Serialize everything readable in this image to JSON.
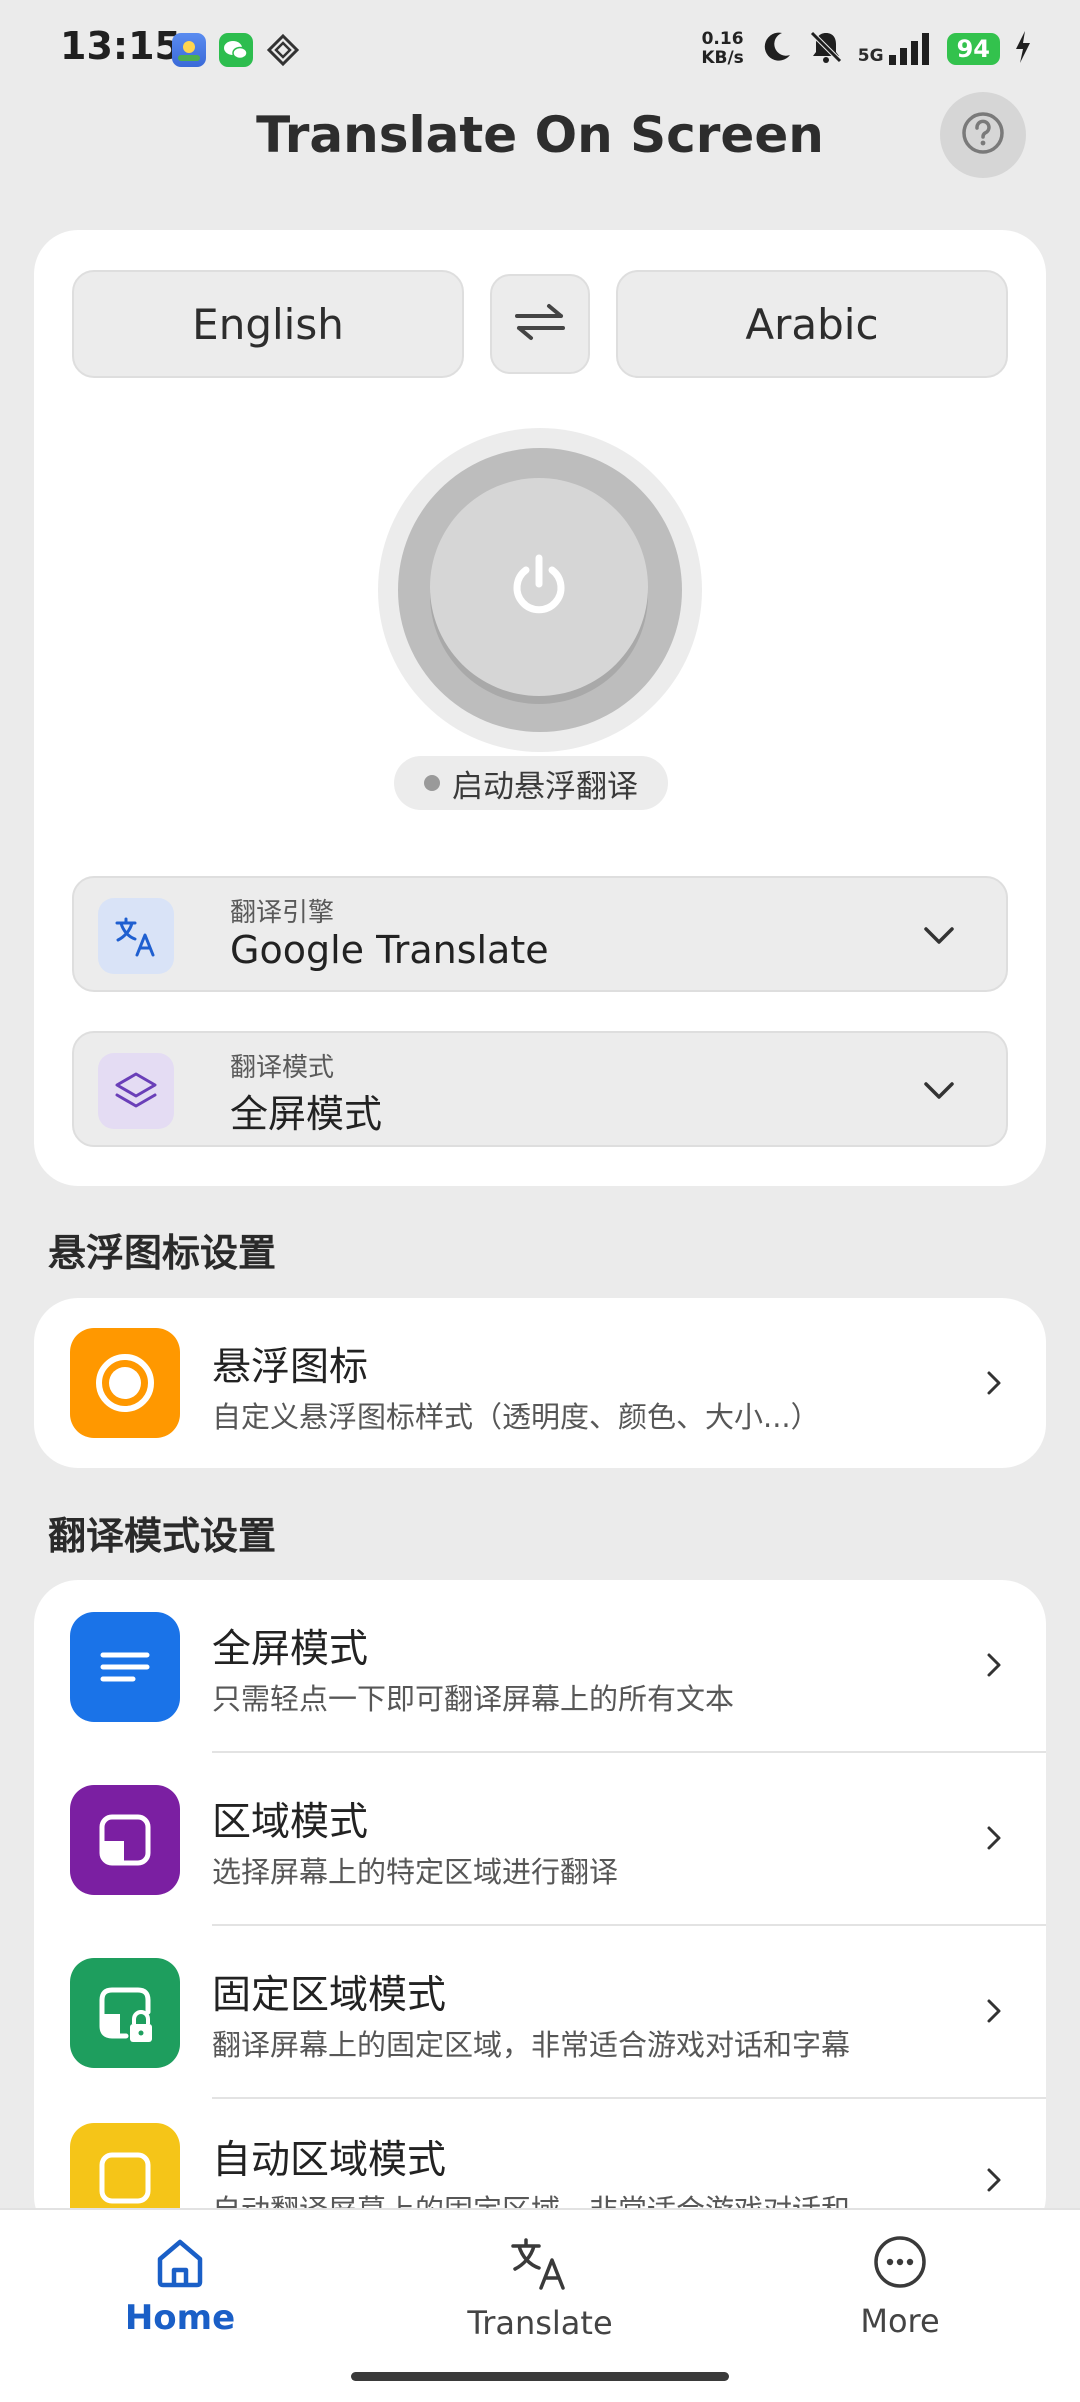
{
  "status_bar": {
    "time": "13:15",
    "net_speed_value": "0.16",
    "net_speed_unit": "KB/s",
    "network": "5G",
    "battery": "94",
    "app_icons": [
      "gallery-app-icon",
      "wechat-icon",
      "vpn-icon"
    ],
    "right_icons": [
      "moon-icon",
      "bell-off-icon",
      "signal-icon",
      "charging-icon"
    ]
  },
  "header": {
    "title": "Translate On Screen",
    "help_icon": "help-icon"
  },
  "languages": {
    "source": "English",
    "target": "Arabic",
    "swap_icon": "swap-icon"
  },
  "power": {
    "icon": "power-icon",
    "status": "启动悬浮翻译"
  },
  "engine": {
    "label": "翻译引擎",
    "value": "Google Translate",
    "icon": "translate-icon"
  },
  "mode": {
    "label": "翻译模式",
    "value": "全屏模式",
    "icon": "layers-icon"
  },
  "floating_section": {
    "title": "悬浮图标设置",
    "item": {
      "title": "悬浮图标",
      "subtitle": "自定义悬浮图标样式（透明度、颜色、大小...）",
      "icon": "floating-icon",
      "color": "#ff9800"
    }
  },
  "modes_section": {
    "title": "翻译模式设置",
    "items": [
      {
        "title": "全屏模式",
        "subtitle": "只需轻点一下即可翻译屏幕上的所有文本",
        "icon": "fullscreen-lines-icon",
        "color": "#1a73e8"
      },
      {
        "title": "区域模式",
        "subtitle": "选择屏幕上的特定区域进行翻译",
        "icon": "area-select-icon",
        "color": "#7b1fa2"
      },
      {
        "title": "固定区域模式",
        "subtitle": "翻译屏幕上的固定区域，非常适合游戏对话和字幕",
        "icon": "fixed-area-lock-icon",
        "color": "#1e9e5e"
      },
      {
        "title": "自动区域模式",
        "subtitle": "自动翻译屏幕上的固定区域，非常适合游戏对话和",
        "icon": "auto-area-icon",
        "color": "#f5c518"
      }
    ]
  },
  "nav": {
    "items": [
      {
        "label": "Home",
        "icon": "home-icon",
        "active": true
      },
      {
        "label": "Translate",
        "icon": "translate-nav-icon",
        "active": false
      },
      {
        "label": "More",
        "icon": "more-icon",
        "active": false
      }
    ],
    "active_color": "#1a5fc7"
  }
}
